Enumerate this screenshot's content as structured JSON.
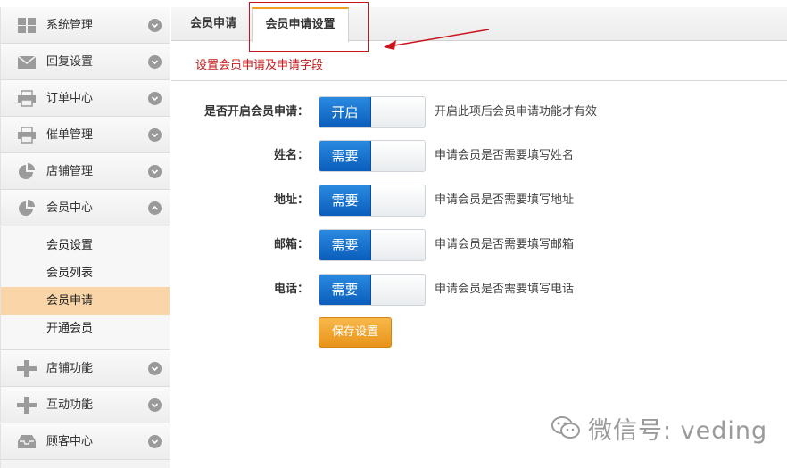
{
  "sidebar": {
    "items": [
      {
        "label": "系统管理",
        "icon": "grid-icon"
      },
      {
        "label": "回复设置",
        "icon": "envelope-icon"
      },
      {
        "label": "订单中心",
        "icon": "printer-icon"
      },
      {
        "label": "催单管理",
        "icon": "printer-icon"
      },
      {
        "label": "店铺管理",
        "icon": "pie-chart-icon"
      },
      {
        "label": "会员中心",
        "icon": "pie-chart-icon",
        "expanded": true
      }
    ],
    "subitems": [
      "会员设置",
      "会员列表",
      "会员申请",
      "开通会员"
    ],
    "active_subitem": "会员申请",
    "items_after": [
      {
        "label": "店铺功能",
        "icon": "plus-icon"
      },
      {
        "label": "互动功能",
        "icon": "plus-icon"
      },
      {
        "label": "顾客中心",
        "icon": "inbox-icon"
      }
    ]
  },
  "tabs": [
    {
      "label": "会员申请"
    },
    {
      "label": "会员申请设置",
      "active": true
    }
  ],
  "subtitle": "设置会员申请及申请字段",
  "form": {
    "rows": [
      {
        "label": "是否开启会员申请：",
        "toggle": "开启",
        "hint": "开启此项后会员申请功能才有效"
      },
      {
        "label": "姓名：",
        "toggle": "需要",
        "hint": "申请会员是否需要填写姓名"
      },
      {
        "label": "地址：",
        "toggle": "需要",
        "hint": "申请会员是否需要填写地址"
      },
      {
        "label": "邮箱：",
        "toggle": "需要",
        "hint": "申请会员是否需要填写邮箱"
      },
      {
        "label": "电话：",
        "toggle": "需要",
        "hint": "申请会员是否需要填写电话"
      }
    ],
    "save_label": "保存设置"
  },
  "watermark": {
    "text": "微信号: veding"
  },
  "colors": {
    "active_tab_accent": "#f0a020",
    "toggle_on": "#0b5dbb",
    "save_button": "#e8931a",
    "active_subitem": "#f9d5a8",
    "annotation_red": "#c9141b"
  }
}
